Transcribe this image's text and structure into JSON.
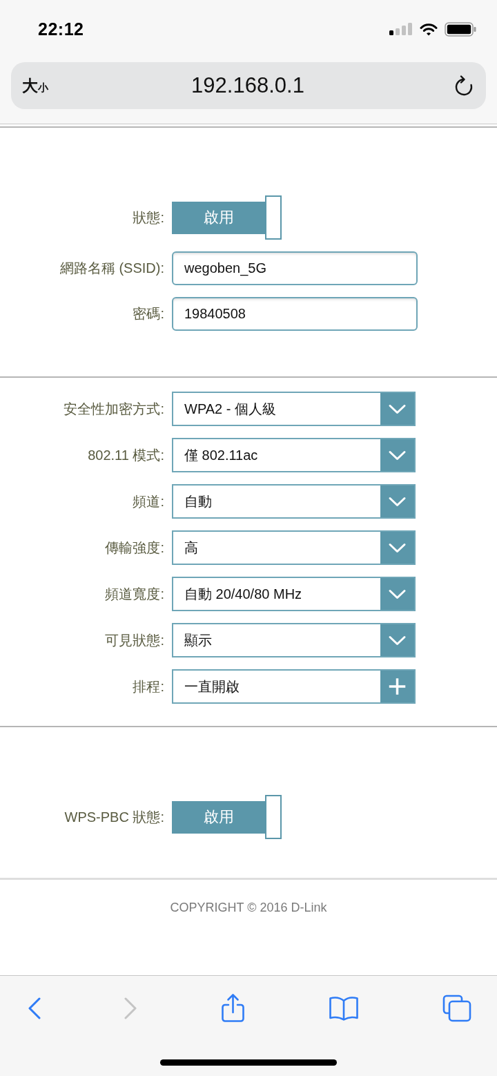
{
  "status_bar": {
    "time": "22:12"
  },
  "address_bar": {
    "text_size": "大小",
    "url": "192.168.0.1"
  },
  "sections": [
    {
      "rows": [
        {
          "kind": "toggle",
          "label": "狀態:",
          "value": "啟用",
          "on": true
        },
        {
          "kind": "input",
          "label": "網路名稱 (SSID):",
          "value": "wegoben_5G"
        },
        {
          "kind": "input",
          "label": "密碼:",
          "value": "19840508"
        }
      ]
    },
    {
      "rows": [
        {
          "kind": "select",
          "label": "安全性加密方式:",
          "value": "WPA2 - 個人級"
        },
        {
          "kind": "select",
          "label": "802.11 模式:",
          "value": "僅 802.11ac"
        },
        {
          "kind": "select",
          "label": "頻道:",
          "value": "自動"
        },
        {
          "kind": "select",
          "label": "傳輸強度:",
          "value": "高"
        },
        {
          "kind": "select",
          "label": "頻道寬度:",
          "value": "自動 20/40/80 MHz"
        },
        {
          "kind": "select",
          "label": "可見狀態:",
          "value": "顯示"
        },
        {
          "kind": "add",
          "label": "排程:",
          "value": "一直開啟"
        }
      ]
    },
    {
      "rows": [
        {
          "kind": "toggle",
          "label": "WPS-PBC 狀態:",
          "value": "啟用",
          "on": true
        }
      ]
    }
  ],
  "footer": {
    "copyright": "COPYRIGHT © 2016 D-Link"
  },
  "toolbar": [
    {
      "kind": "back",
      "disabled": false
    },
    {
      "kind": "forward",
      "disabled": true
    },
    {
      "kind": "share",
      "disabled": false
    },
    {
      "kind": "bookmarks",
      "disabled": false
    },
    {
      "kind": "tabs",
      "disabled": false
    }
  ]
}
